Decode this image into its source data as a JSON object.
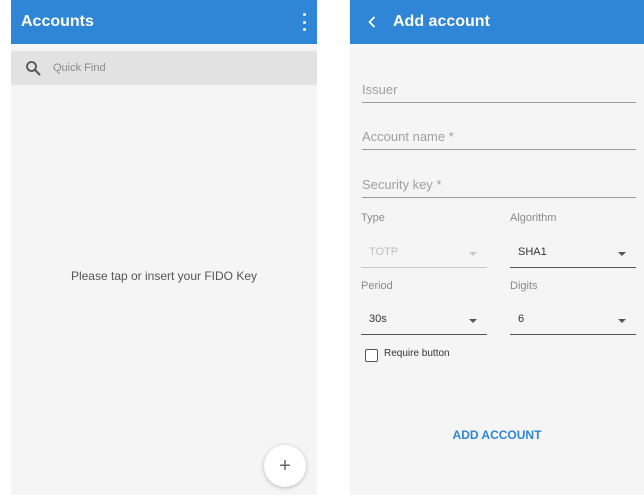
{
  "accounts_screen": {
    "appbar": {
      "title": "Accounts",
      "menu_icon": "more-vertical-icon"
    },
    "search": {
      "icon": "search-icon",
      "placeholder": "Quick Find"
    },
    "empty_message": "Please tap or insert your FIDO Key",
    "fab": {
      "icon": "plus-icon",
      "label": "+"
    }
  },
  "add_account_screen": {
    "appbar": {
      "title": "Add account",
      "back_icon": "chevron-left-icon"
    },
    "fields": {
      "issuer": "Issuer",
      "account_name": "Account name *",
      "security_key": "Security key *"
    },
    "type": {
      "label": "Type",
      "value": "TOTP",
      "disabled": true
    },
    "algorithm": {
      "label": "Algorithm",
      "value": "SHA1"
    },
    "period": {
      "label": "Period",
      "value": "30s"
    },
    "digits": {
      "label": "Digits",
      "value": "6"
    },
    "require_button": {
      "label": "Require button",
      "checked": false
    },
    "submit_label": "ADD ACCOUNT"
  },
  "colors": {
    "appbar": "#2f86d6",
    "background": "#f5f5f5",
    "search_bar": "#e2e2e2",
    "accent_text": "#2f86d6"
  }
}
